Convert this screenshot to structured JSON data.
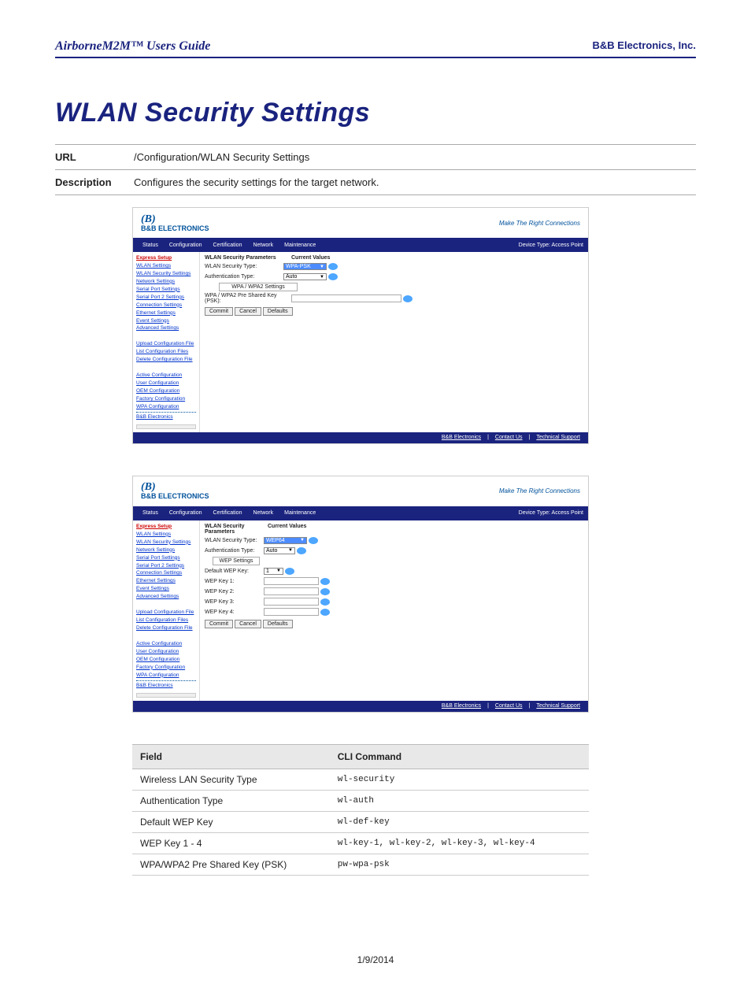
{
  "header": {
    "left": "AirborneM2M™ Users Guide",
    "right": "B&B Electronics, Inc."
  },
  "title": "WLAN Security Settings",
  "info": {
    "url_label": "URL",
    "url_value": "/Configuration/WLAN Security Settings",
    "desc_label": "Description",
    "desc_value": "Configures the security settings for the target network."
  },
  "sidebar": {
    "items": [
      {
        "label": "Express Setup",
        "active": true
      },
      {
        "label": "WLAN Settings",
        "active": false
      },
      {
        "label": "WLAN Security Settings",
        "active": false
      },
      {
        "label": "Network Settings",
        "active": false
      },
      {
        "label": "Serial Port Settings",
        "active": false
      },
      {
        "label": "Serial Port 2 Settings",
        "active": false
      },
      {
        "label": "Connection Settings",
        "active": false
      },
      {
        "label": "Ethernet Settings",
        "active": false
      },
      {
        "label": "Event Settings",
        "active": false
      },
      {
        "label": "Advanced Settings",
        "active": false
      }
    ],
    "group2": [
      {
        "label": "Upload Configuration File"
      },
      {
        "label": "List Configuration Files"
      },
      {
        "label": "Delete Configuration File"
      }
    ],
    "group3": [
      {
        "label": "Active Configuration"
      },
      {
        "label": "User Configuration"
      },
      {
        "label": "OEM Configuration"
      },
      {
        "label": "Factory Configuration"
      },
      {
        "label": "WPA Configuration"
      }
    ],
    "bottom": "B&B Electronics"
  },
  "app": {
    "company": "B&B ELECTRONICS",
    "tagline": "Make The Right Connections",
    "nav": [
      "Status",
      "Configuration",
      "Certification",
      "Network",
      "Maintenance"
    ],
    "device_label": "Device Type: Access Point",
    "footer_links": [
      "B&B Electronics",
      "Contact Us",
      "Technical Support"
    ]
  },
  "panel1": {
    "section_header": "WLAN Security Parameters",
    "current_values": "Current Values",
    "rows": {
      "sec_type": {
        "label": "WLAN Security Type:",
        "value": "WPA-PSK"
      },
      "auth_type": {
        "label": "Authentication Type:",
        "value": "Auto"
      },
      "subsection": "WPA / WPA2 Settings",
      "psk": {
        "label": "WPA / WPA2 Pre Shared Key (PSK):"
      }
    },
    "buttons": [
      "Commit",
      "Cancel",
      "Defaults"
    ]
  },
  "panel2": {
    "section_header": "WLAN Security Parameters",
    "current_values": "Current Values",
    "rows": {
      "sec_type": {
        "label": "WLAN Security Type:",
        "value": "WEP64"
      },
      "auth_type": {
        "label": "Authentication Type:",
        "value": "Auto"
      },
      "subsection": "WEP Settings",
      "def_key": {
        "label": "Default WEP Key:",
        "value": "1"
      },
      "k1": {
        "label": "WEP Key 1:"
      },
      "k2": {
        "label": "WEP Key 2:"
      },
      "k3": {
        "label": "WEP Key 3:"
      },
      "k4": {
        "label": "WEP Key 4:"
      }
    },
    "buttons": [
      "Commit",
      "Cancel",
      "Defaults"
    ]
  },
  "cli": {
    "headers": [
      "Field",
      "CLI Command"
    ],
    "rows": [
      {
        "field": "Wireless LAN Security Type",
        "cmd": "wl-security"
      },
      {
        "field": "Authentication Type",
        "cmd": "wl-auth"
      },
      {
        "field": "Default WEP Key",
        "cmd": "wl-def-key"
      },
      {
        "field": "WEP Key 1 - 4",
        "cmd": "wl-key-1, wl-key-2, wl-key-3, wl-key-4"
      },
      {
        "field": "WPA/WPA2 Pre Shared Key (PSK)",
        "cmd": "pw-wpa-psk"
      }
    ]
  },
  "footer_date": "1/9/2014"
}
